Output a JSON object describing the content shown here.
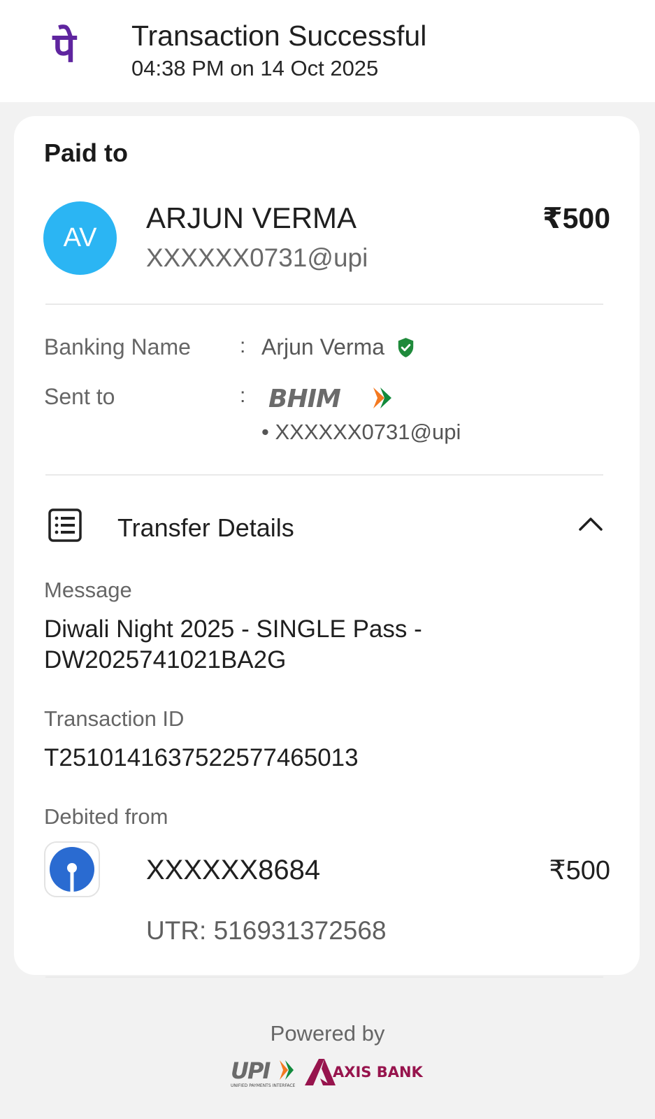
{
  "header": {
    "title": "Transaction Successful",
    "datetime": "04:38 PM on 14 Oct 2025",
    "app_logo_glyph": "पे",
    "brand_color": "#5f259f"
  },
  "payment": {
    "section_label": "Paid to",
    "avatar_initials": "AV",
    "avatar_color": "#2bb5f3",
    "payee_name": "ARJUN VERMA",
    "payee_upi": "XXXXXX0731@upi",
    "amount": "₹500"
  },
  "details": {
    "banking_name_label": "Banking Name",
    "colon": ":",
    "banking_name_value": "Arjun Verma",
    "verified_icon": "shield-check-icon",
    "verified_color": "#1f8a3b",
    "sent_to_label": "Sent to",
    "sent_to_logo_text": "BHIM",
    "sent_to_upi": "• XXXXXX0731@upi"
  },
  "transfer": {
    "title": "Transfer Details",
    "message_label": "Message",
    "message_line1": "Diwali Night 2025 - SINGLE Pass -",
    "message_line2": "DW2025741021BA2G",
    "transaction_id_label": "Transaction ID",
    "transaction_id": "T2510141637522577465013",
    "debited_from_label": "Debited from",
    "account_number": "XXXXXX8684",
    "debited_amount": "₹500",
    "utr": "UTR: 516931372568",
    "bank_logo_color": "#2a6bd1"
  },
  "footer": {
    "powered_by": "Powered by",
    "upi_logo_text": "UPI",
    "upi_tagline": "UNIFIED PAYMENTS INTERFACE",
    "axis_logo_text": "AXIS BANK",
    "axis_color": "#97144d"
  }
}
